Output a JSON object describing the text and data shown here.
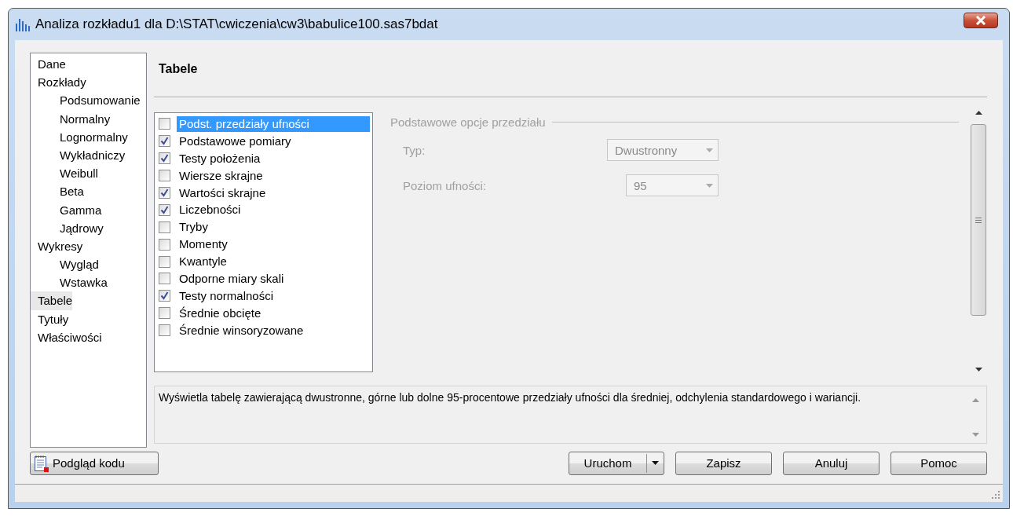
{
  "window": {
    "title": "Analiza rozkładu1 dla D:\\STAT\\cwiczenia\\cw3\\babulice100.sas7bdat"
  },
  "sidebar": {
    "items": [
      {
        "label": "Dane",
        "selected": false
      },
      {
        "label": "Rozkłady",
        "selected": false,
        "children": [
          {
            "label": "Podsumowanie",
            "selected": false
          },
          {
            "label": "Normalny",
            "selected": false
          },
          {
            "label": "Lognormalny",
            "selected": false
          },
          {
            "label": "Wykładniczy",
            "selected": false
          },
          {
            "label": "Weibull",
            "selected": false
          },
          {
            "label": "Beta",
            "selected": false
          },
          {
            "label": "Gamma",
            "selected": false
          },
          {
            "label": "Jądrowy",
            "selected": false
          }
        ]
      },
      {
        "label": "Wykresy",
        "selected": false,
        "children": [
          {
            "label": "Wygląd",
            "selected": false
          },
          {
            "label": "Wstawka",
            "selected": false
          }
        ]
      },
      {
        "label": "Tabele",
        "selected": true
      },
      {
        "label": "Tytuły",
        "selected": false
      },
      {
        "label": "Właściwości",
        "selected": false
      }
    ]
  },
  "page_title": "Tabele",
  "tables": [
    {
      "label": "Podst. przedziały ufności",
      "checked": false,
      "selected": true
    },
    {
      "label": "Podstawowe pomiary",
      "checked": true,
      "selected": false
    },
    {
      "label": "Testy położenia",
      "checked": true,
      "selected": false
    },
    {
      "label": "Wiersze skrajne",
      "checked": false,
      "selected": false
    },
    {
      "label": "Wartości skrajne",
      "checked": true,
      "selected": false
    },
    {
      "label": "Liczebności",
      "checked": true,
      "selected": false
    },
    {
      "label": "Tryby",
      "checked": false,
      "selected": false
    },
    {
      "label": "Momenty",
      "checked": false,
      "selected": false
    },
    {
      "label": "Kwantyle",
      "checked": false,
      "selected": false
    },
    {
      "label": "Odporne miary skali",
      "checked": false,
      "selected": false
    },
    {
      "label": "Testy normalności",
      "checked": true,
      "selected": false
    },
    {
      "label": "Średnie obcięte",
      "checked": false,
      "selected": false
    },
    {
      "label": "Średnie winsoryzowane",
      "checked": false,
      "selected": false
    }
  ],
  "options_group": {
    "title": "Podstawowe opcje przedziału",
    "disabled": true,
    "fields": [
      {
        "label": "Typ:",
        "value": "Dwustronny",
        "disabled": true
      },
      {
        "label": "Poziom ufności:",
        "value": "95",
        "disabled": true
      }
    ]
  },
  "description": "Wyświetla tabelę zawierającą dwustronne, górne lub dolne 95-procentowe przedziały ufności dla średniej, odchylenia standardowego i wariancji.",
  "buttons": {
    "preview": "Podgląd kodu",
    "run": "Uruchom",
    "save": "Zapisz",
    "cancel": "Anuluj",
    "help": "Pomoc"
  }
}
